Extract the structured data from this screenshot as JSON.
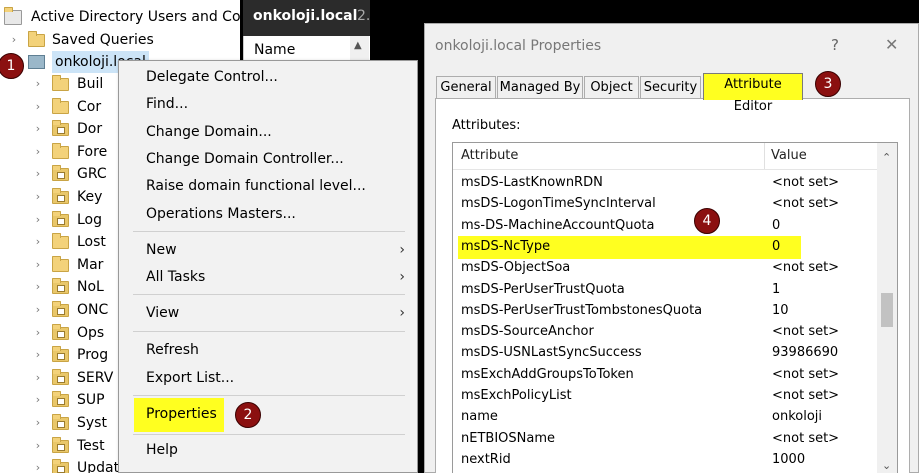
{
  "tree": {
    "root": "Active Directory Users and Com",
    "saved_queries": "Saved Queries",
    "domain": "onkoloji.local",
    "items": [
      "Buil",
      "Cor",
      "Dor",
      "Fore",
      "GRC",
      "Key",
      "Log",
      "Lost",
      "Mar",
      "NoL",
      "ONC",
      "Ops",
      "Prog",
      "SERV",
      "SUP",
      "Syst",
      "Test",
      "UpdateServer"
    ]
  },
  "middle": {
    "title": "onkoloji.local",
    "title_suffix": "2.",
    "col_name": "Name"
  },
  "context_menu": {
    "items": [
      {
        "label": "Delegate Control..."
      },
      {
        "label": "Find..."
      },
      {
        "label": "Change Domain..."
      },
      {
        "label": "Change Domain Controller..."
      },
      {
        "label": "Raise domain functional level..."
      },
      {
        "label": "Operations Masters..."
      },
      {
        "label": "New"
      },
      {
        "label": "All Tasks"
      },
      {
        "label": "View"
      },
      {
        "label": "Refresh"
      },
      {
        "label": "Export List..."
      },
      {
        "label": "Properties"
      },
      {
        "label": "Help"
      }
    ]
  },
  "dialog": {
    "title": "onkoloji.local Properties",
    "help_glyph": "?",
    "close_glyph": "✕",
    "tabs": [
      "General",
      "Managed By",
      "Object",
      "Security",
      "Attribute Editor"
    ],
    "attributes_label": "Attributes:",
    "col_attribute": "Attribute",
    "col_value": "Value",
    "rows": [
      {
        "attribute": "msDS-LastKnownRDN",
        "value": "<not set>"
      },
      {
        "attribute": "msDS-LogonTimeSyncInterval",
        "value": "<not set>"
      },
      {
        "attribute": "ms-DS-MachineAccountQuota",
        "value": "0"
      },
      {
        "attribute": "msDS-NcType",
        "value": "0"
      },
      {
        "attribute": "msDS-ObjectSoa",
        "value": "<not set>"
      },
      {
        "attribute": "msDS-PerUserTrustQuota",
        "value": "1"
      },
      {
        "attribute": "msDS-PerUserTrustTombstonesQuota",
        "value": "10"
      },
      {
        "attribute": "msDS-SourceAnchor",
        "value": "<not set>"
      },
      {
        "attribute": "msDS-USNLastSyncSuccess",
        "value": "93986690"
      },
      {
        "attribute": "msExchAddGroupsToToken",
        "value": "<not set>"
      },
      {
        "attribute": "msExchPolicyList",
        "value": "<not set>"
      },
      {
        "attribute": "name",
        "value": "onkoloji"
      },
      {
        "attribute": "nETBIOSName",
        "value": "<not set>"
      },
      {
        "attribute": "nextRid",
        "value": "1000"
      }
    ]
  },
  "badges": [
    "1",
    "2",
    "3",
    "4"
  ],
  "colors": {
    "highlight": "#ffff20",
    "badge": "#8b1010"
  }
}
